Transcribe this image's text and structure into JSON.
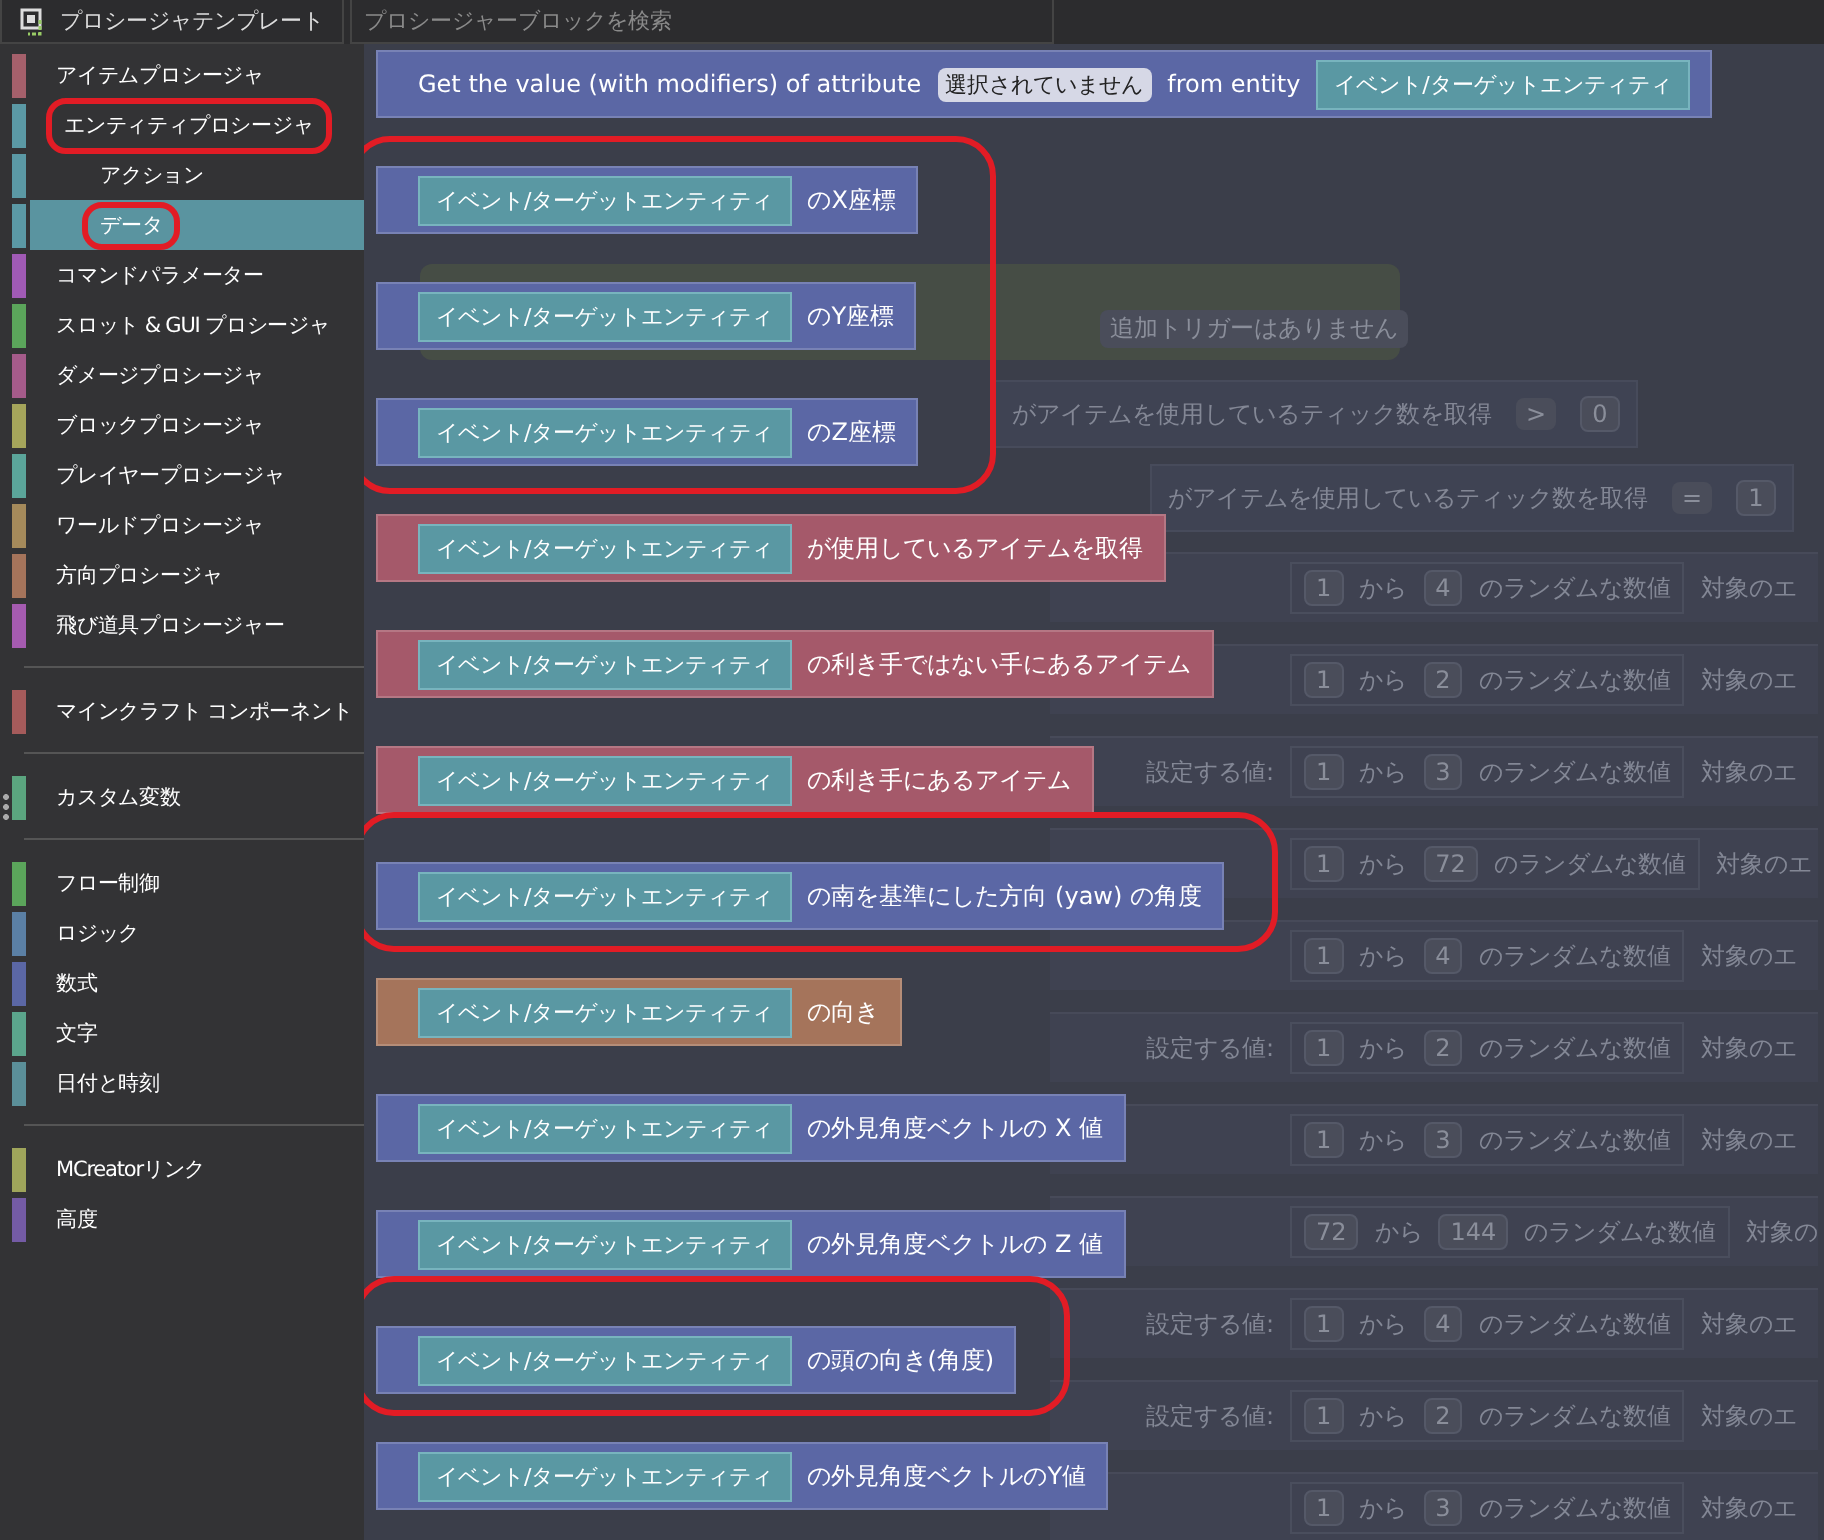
{
  "toolbar": {
    "template_tab": "プロシージャテンプレート",
    "search": {
      "placeholder": "プロシージャーブロックを検索"
    }
  },
  "sidebar": {
    "sections": [
      [
        {
          "label": "アイテムプロシージャ",
          "color": "#a5606b",
          "selected": false,
          "highlighted": false
        },
        {
          "label": "エンティティプロシージャ",
          "color": "#5b99a5",
          "selected": false,
          "highlighted": true,
          "children": [
            {
              "label": "アクション",
              "color": "#5b99a5",
              "selected": false,
              "highlighted": false
            },
            {
              "label": "データ",
              "color": "#5b99a5",
              "selected": true,
              "highlighted": true
            }
          ]
        },
        {
          "label": "コマンドパラメーター",
          "color": "#a05ab5",
          "selected": false,
          "highlighted": false
        },
        {
          "label": "スロット & GUI プロシージャ",
          "color": "#5ba55b",
          "selected": false,
          "highlighted": false
        },
        {
          "label": "ダメージプロシージャ",
          "color": "#a55b8a",
          "selected": false,
          "highlighted": false
        },
        {
          "label": "ブロックプロシージャ",
          "color": "#a5a55b",
          "selected": false,
          "highlighted": false
        },
        {
          "label": "プレイヤープロシージャ",
          "color": "#5ba59a",
          "selected": false,
          "highlighted": false
        },
        {
          "label": "ワールドプロシージャ",
          "color": "#a58a5b",
          "selected": false,
          "highlighted": false
        },
        {
          "label": "方向プロシージャ",
          "color": "#a5745b",
          "selected": false,
          "highlighted": false
        },
        {
          "label": "飛び道具プロシージャー",
          "color": "#a55bb0",
          "selected": false,
          "highlighted": false
        }
      ],
      [
        {
          "label": "マインクラフト コンポーネント",
          "color": "#a55b5b",
          "selected": false,
          "highlighted": false
        }
      ],
      [
        {
          "label": "カスタム変数",
          "color": "#5ba57f",
          "selected": false,
          "highlighted": false
        }
      ],
      [
        {
          "label": "フロー制御",
          "color": "#5ba55b",
          "selected": false,
          "highlighted": false
        },
        {
          "label": "ロジック",
          "color": "#5b80a5",
          "selected": false,
          "highlighted": false
        },
        {
          "label": "数式",
          "color": "#5b67a5",
          "selected": false,
          "highlighted": false
        },
        {
          "label": "文字",
          "color": "#5ba58c",
          "selected": false,
          "highlighted": false
        },
        {
          "label": "日付と時刻",
          "color": "#5b8f99",
          "selected": false,
          "highlighted": false
        }
      ],
      [
        {
          "label": "MCreatorリンク",
          "color": "#9fa55b",
          "selected": false,
          "highlighted": false
        },
        {
          "label": "高度",
          "color": "#745ba5",
          "selected": false,
          "highlighted": false
        }
      ]
    ]
  },
  "workspace": {
    "event": {
      "trigger": "追加トリガーはありません"
    },
    "conditions": [
      {
        "text": "がアイテムを使用しているティック数を取得",
        "operator": ">",
        "value": "0"
      },
      {
        "text": "がアイテムを使用しているティック数を取得",
        "operator": "=",
        "value": "1"
      }
    ],
    "rows": [
      {
        "min": "1",
        "range": "から",
        "max": "4",
        "result": "のランダムな数値",
        "target": "対象のエ"
      },
      {
        "min": "1",
        "range": "から",
        "max": "2",
        "result": "のランダムな数値",
        "target": "対象のエ"
      },
      {
        "label": "設定する値:",
        "min": "1",
        "range": "から",
        "max": "3",
        "result": "のランダムな数値",
        "target": "対象のエ"
      },
      {
        "min": "1",
        "range": "から",
        "max": "72",
        "result": "のランダムな数値",
        "target": "対象のエ"
      },
      {
        "min": "1",
        "range": "から",
        "max": "4",
        "result": "のランダムな数値",
        "target": "対象のエ"
      },
      {
        "label": "設定する値:",
        "min": "1",
        "range": "から",
        "max": "2",
        "result": "のランダムな数値",
        "target": "対象のエ"
      },
      {
        "min": "1",
        "range": "から",
        "max": "3",
        "result": "のランダムな数値",
        "target": "対象のエ"
      },
      {
        "min": "72",
        "range": "から",
        "max": "144",
        "result": "のランダムな数値",
        "target": "対象の"
      },
      {
        "label": "設定する値:",
        "min": "1",
        "range": "から",
        "max": "4",
        "result": "のランダムな数値",
        "target": "対象のエ"
      },
      {
        "label": "設定する値:",
        "min": "1",
        "range": "から",
        "max": "2",
        "result": "のランダムな数値",
        "target": "対象のエ"
      },
      {
        "min": "1",
        "range": "から",
        "max": "3",
        "result": "のランダムな数値",
        "target": "対象のエ"
      }
    ]
  },
  "flyout": {
    "items": [
      {
        "kind": "block",
        "color": "#5b67a5",
        "highlighted": false,
        "parts": [
          {
            "kind": "text",
            "text": "Get the value (with modifiers) of attribute"
          },
          {
            "kind": "dropdown",
            "text": "選択されていません"
          },
          {
            "kind": "text",
            "text": "from entity"
          },
          {
            "kind": "socket",
            "text": "イベント/ターゲットエンティティ"
          }
        ]
      },
      {
        "kind": "group",
        "highlighted": true,
        "blocks": [
          {
            "kind": "block",
            "color": "#5b67a5",
            "highlighted": false,
            "parts": [
              {
                "kind": "socket",
                "text": "イベント/ターゲットエンティティ"
              },
              {
                "kind": "text",
                "text": "のX座標"
              }
            ]
          },
          {
            "kind": "block",
            "color": "#5b67a5",
            "highlighted": false,
            "parts": [
              {
                "kind": "socket",
                "text": "イベント/ターゲットエンティティ"
              },
              {
                "kind": "text",
                "text": "のY座標"
              }
            ]
          },
          {
            "kind": "block",
            "color": "#5b67a5",
            "highlighted": false,
            "parts": [
              {
                "kind": "socket",
                "text": "イベント/ターゲットエンティティ"
              },
              {
                "kind": "text",
                "text": "のZ座標"
              }
            ]
          }
        ]
      },
      {
        "kind": "block",
        "color": "#a5596a",
        "highlighted": false,
        "parts": [
          {
            "kind": "socket",
            "text": "イベント/ターゲットエンティティ"
          },
          {
            "kind": "text",
            "text": "が使用しているアイテムを取得"
          }
        ]
      },
      {
        "kind": "block",
        "color": "#a5596a",
        "highlighted": false,
        "parts": [
          {
            "kind": "socket",
            "text": "イベント/ターゲットエンティティ"
          },
          {
            "kind": "text",
            "text": "の利き手ではない手にあるアイテム"
          }
        ]
      },
      {
        "kind": "block",
        "color": "#a5596a",
        "highlighted": false,
        "parts": [
          {
            "kind": "socket",
            "text": "イベント/ターゲットエンティティ"
          },
          {
            "kind": "text",
            "text": "の利き手にあるアイテム"
          }
        ]
      },
      {
        "kind": "block",
        "color": "#5b67a5",
        "highlighted": true,
        "parts": [
          {
            "kind": "socket",
            "text": "イベント/ターゲットエンティティ"
          },
          {
            "kind": "text",
            "text": "の南を基準にした方向 (yaw) の角度"
          }
        ]
      },
      {
        "kind": "block",
        "color": "#a5745b",
        "highlighted": false,
        "parts": [
          {
            "kind": "socket",
            "text": "イベント/ターゲットエンティティ"
          },
          {
            "kind": "text",
            "text": "の向き"
          }
        ]
      },
      {
        "kind": "block",
        "color": "#5b67a5",
        "highlighted": false,
        "parts": [
          {
            "kind": "socket",
            "text": "イベント/ターゲットエンティティ"
          },
          {
            "kind": "text",
            "text": "の外見角度ベクトルの X 値"
          }
        ]
      },
      {
        "kind": "block",
        "color": "#5b67a5",
        "highlighted": false,
        "parts": [
          {
            "kind": "socket",
            "text": "イベント/ターゲットエンティティ"
          },
          {
            "kind": "text",
            "text": "の外見角度ベクトルの Z 値"
          }
        ]
      },
      {
        "kind": "block",
        "color": "#5b67a5",
        "highlighted": true,
        "parts": [
          {
            "kind": "socket",
            "text": "イベント/ターゲットエンティティ"
          },
          {
            "kind": "text",
            "text": "の頭の向き(角度)"
          }
        ]
      },
      {
        "kind": "block",
        "color": "#5b67a5",
        "highlighted": false,
        "parts": [
          {
            "kind": "socket",
            "text": "イベント/ターゲットエンティティ"
          },
          {
            "kind": "text",
            "text": "の外見角度ベクトルのY値"
          }
        ]
      }
    ]
  }
}
